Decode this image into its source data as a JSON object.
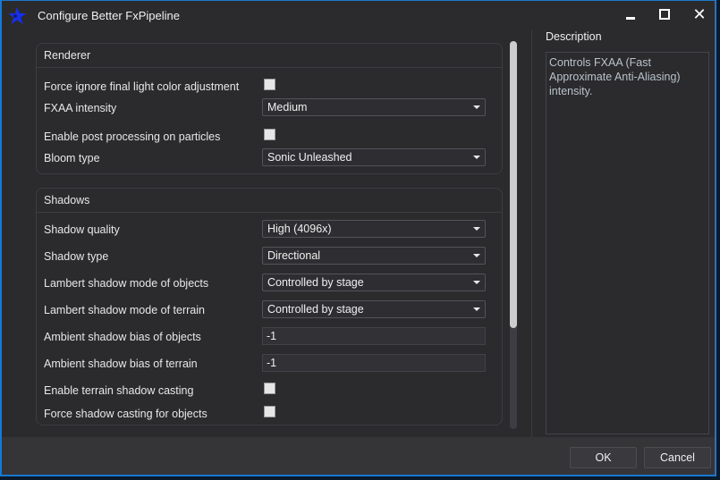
{
  "window": {
    "title": "Configure Better FxPipeline",
    "icon": "star-logo-icon",
    "controls": {
      "minimize": "minimize-icon",
      "maximize": "maximize-icon",
      "close": "✕"
    }
  },
  "groups": [
    {
      "title": "Renderer",
      "rows": [
        {
          "label": "Force ignore final light color adjustment",
          "type": "checkbox",
          "checked": false
        },
        {
          "label": "FXAA intensity",
          "type": "select",
          "value": "Medium"
        },
        {
          "label": "Enable post processing on particles",
          "type": "checkbox",
          "checked": false
        },
        {
          "label": "Bloom type",
          "type": "select",
          "value": "Sonic Unleashed"
        }
      ]
    },
    {
      "title": "Shadows",
      "rows": [
        {
          "label": "Shadow quality",
          "type": "select",
          "value": "High (4096x)"
        },
        {
          "label": "Shadow type",
          "type": "select",
          "value": "Directional"
        },
        {
          "label": "Lambert shadow mode of objects",
          "type": "select",
          "value": "Controlled by stage"
        },
        {
          "label": "Lambert shadow mode of terrain",
          "type": "select",
          "value": "Controlled by stage"
        },
        {
          "label": "Ambient shadow bias of objects",
          "type": "text",
          "value": "-1"
        },
        {
          "label": "Ambient shadow bias of terrain",
          "type": "text",
          "value": "-1"
        },
        {
          "label": "Enable terrain shadow casting",
          "type": "checkbox",
          "checked": false
        },
        {
          "label": "Force shadow casting for objects",
          "type": "checkbox",
          "checked": false
        }
      ]
    }
  ],
  "description": {
    "title": "Description",
    "text": "Controls FXAA (Fast Approximate Anti-Aliasing) intensity."
  },
  "scroll": {
    "position_fraction": 0.0,
    "visible_fraction": 0.74
  },
  "buttons": {
    "ok": "OK",
    "cancel": "Cancel"
  }
}
